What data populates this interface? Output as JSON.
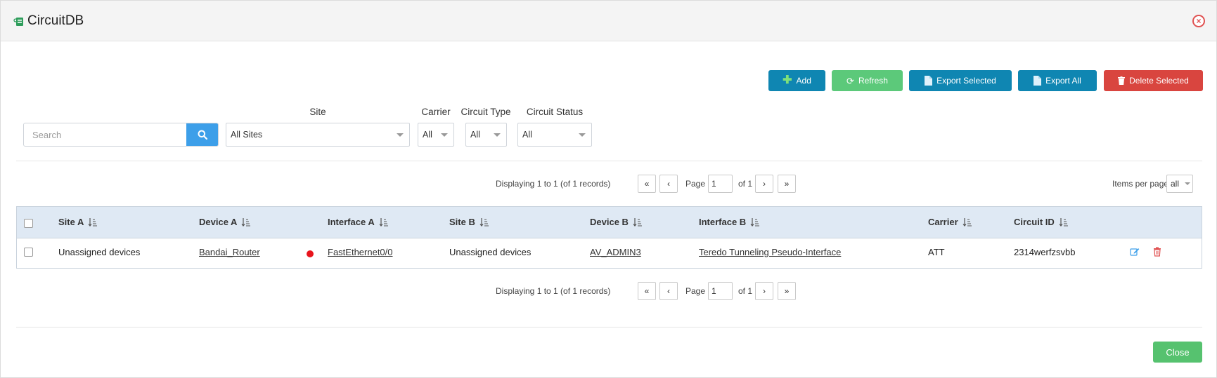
{
  "header": {
    "title": "CircuitDB",
    "icon": "circuit-icon",
    "close_icon": "close-circle-icon"
  },
  "toolbar": {
    "add_label": "Add",
    "refresh_label": "Refresh",
    "export_selected_label": "Export Selected",
    "export_all_label": "Export All",
    "delete_selected_label": "Delete Selected"
  },
  "filters": {
    "search_placeholder": "Search",
    "site_label": "Site",
    "site_value": "All Sites",
    "carrier_label": "Carrier",
    "carrier_value": "All",
    "circuit_type_label": "Circuit Type",
    "circuit_type_value": "All",
    "circuit_status_label": "Circuit Status",
    "circuit_status_value": "All"
  },
  "pagination": {
    "display_text": "Displaying 1 to 1 (of 1 records)",
    "page_label": "Page",
    "page_value": "1",
    "of_text": "of 1",
    "first": "«",
    "prev": "‹",
    "next": "›",
    "last": "»",
    "items_per_page_label": "Items per page",
    "items_per_page_value": "all"
  },
  "table": {
    "columns": [
      "Site A",
      "Device A",
      "Interface A",
      "Site B",
      "Device B",
      "Interface B",
      "Carrier",
      "Circuit ID"
    ],
    "rows": [
      {
        "site_a": "Unassigned devices",
        "device_a": "Bandai_Router",
        "interface_a_status": "down",
        "interface_a": "FastEthernet0/0",
        "site_b": "Unassigned devices",
        "device_b": "AV_ADMIN3",
        "interface_b": "Teredo Tunneling Pseudo-Interface",
        "carrier": "ATT",
        "circuit_id": "2314werfzsvbb"
      }
    ]
  },
  "footer": {
    "close_label": "Close"
  },
  "colors": {
    "primary_blue": "#0f86b2",
    "refresh_green": "#5cc97a",
    "delete_red": "#d9453f",
    "search_blue": "#3d9fe9",
    "header_row": "#dfe9f4",
    "status_down": "#e8141c"
  }
}
